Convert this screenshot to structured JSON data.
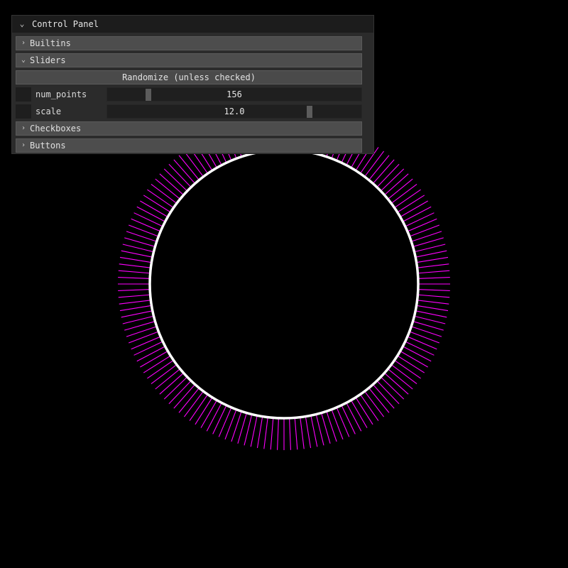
{
  "panel": {
    "title": "Control Panel",
    "sections": [
      {
        "label": "Builtins",
        "expanded": false
      },
      {
        "label": "Sliders",
        "expanded": true
      },
      {
        "label": "Checkboxes",
        "expanded": false
      },
      {
        "label": "Buttons",
        "expanded": false
      }
    ],
    "randomize_label": "Randomize (unless checked)",
    "sliders": [
      {
        "label": "num_points",
        "value": "156",
        "fraction": 0.16
      },
      {
        "label": "scale",
        "value": "12.0",
        "fraction": 0.79
      }
    ]
  },
  "icons": {
    "expanded": "chevron-down-icon",
    "collapsed": "chevron-right-icon"
  },
  "canvas": {
    "num_points": 156,
    "colors": {
      "background": "#000000",
      "circle": "#ffffff",
      "lines": "#ff00ff"
    }
  }
}
